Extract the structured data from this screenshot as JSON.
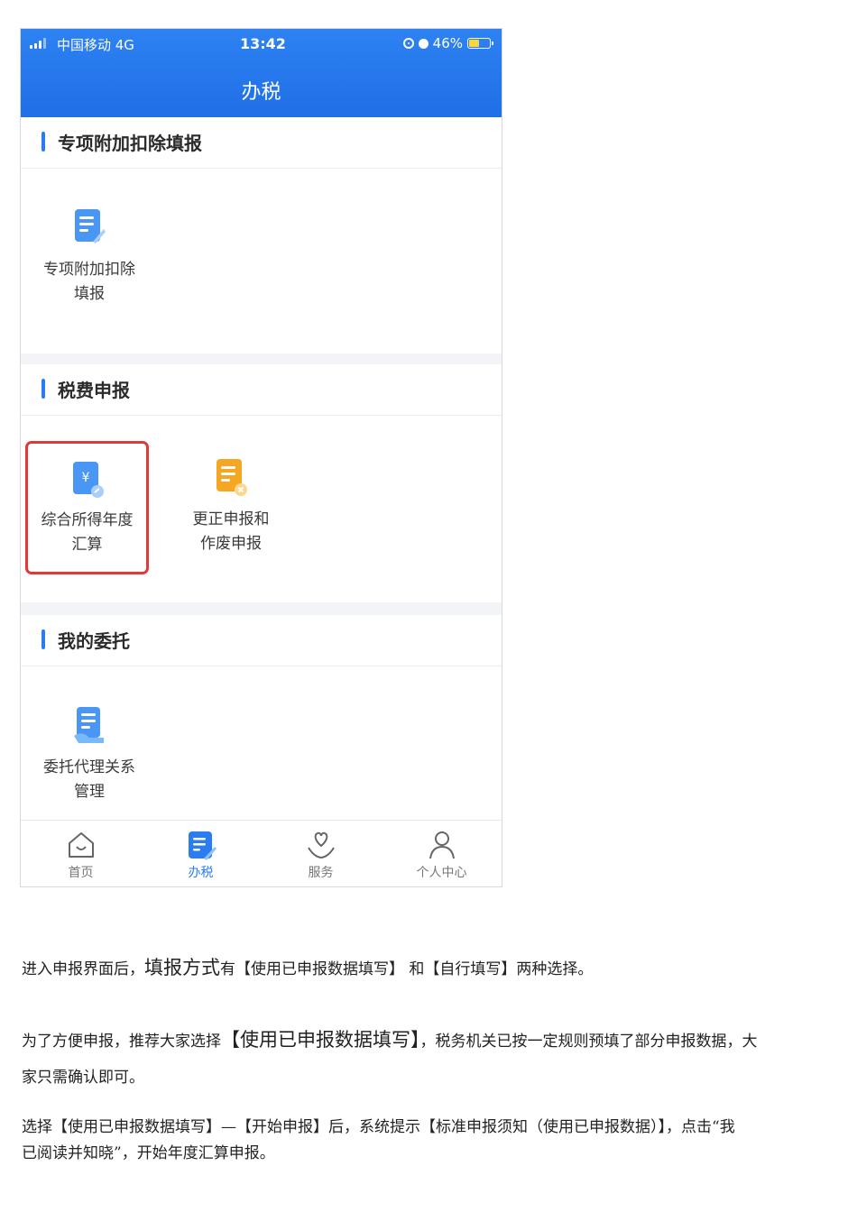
{
  "status_bar": {
    "carrier": "中国移动  4G",
    "time": "13:42",
    "battery": "46%",
    "battery_level": 0.46
  },
  "header": {
    "title": "办税"
  },
  "sections": [
    {
      "title": "专项附加扣除填报",
      "items": [
        {
          "label_line1": "专项附加扣除",
          "label_line2": "填报",
          "icon": "edit-form-icon"
        }
      ]
    },
    {
      "title": "税费申报",
      "items": [
        {
          "label_line1": "综合所得年度",
          "label_line2": "汇算",
          "icon": "yuan-document-icon",
          "highlighted": true
        },
        {
          "label_line1": "更正申报和",
          "label_line2": "作废申报",
          "icon": "correction-document-icon"
        }
      ]
    },
    {
      "title": "我的委托",
      "items": [
        {
          "label_line1": "委托代理关系",
          "label_line2": "管理",
          "icon": "delegation-document-icon"
        }
      ]
    }
  ],
  "tabs": [
    {
      "label": "首页",
      "icon": "home-icon"
    },
    {
      "label": "办税",
      "icon": "tax-icon",
      "active": true
    },
    {
      "label": "服务",
      "icon": "heart-hand-icon"
    },
    {
      "label": "个人中心",
      "icon": "person-icon"
    }
  ],
  "colors": {
    "primary": "#2a7cf0",
    "highlight": "#e0393b",
    "accent_orange": "#f5a623"
  },
  "doc": {
    "p1": {
      "a": "进入申报界面后，",
      "b": "填报方式",
      "c": "有【使用已申报数据填写】 和【自行填写】两种选择。"
    },
    "p2": {
      "a": "为了方便申报，推荐大家选择",
      "b": "【使用已申报数据填写】",
      "c": "，税务机关已按一定规则预填了部分申报数据，大",
      "d": "家只需确认即可。"
    },
    "p3": {
      "line1": "选择【使用已申报数据填写】—【开始申报】后，系统提示【标准申报须知（使用已申报数据）】，点击“我",
      "line2": "已阅读并知晓”，开始年度汇算申报。"
    }
  }
}
